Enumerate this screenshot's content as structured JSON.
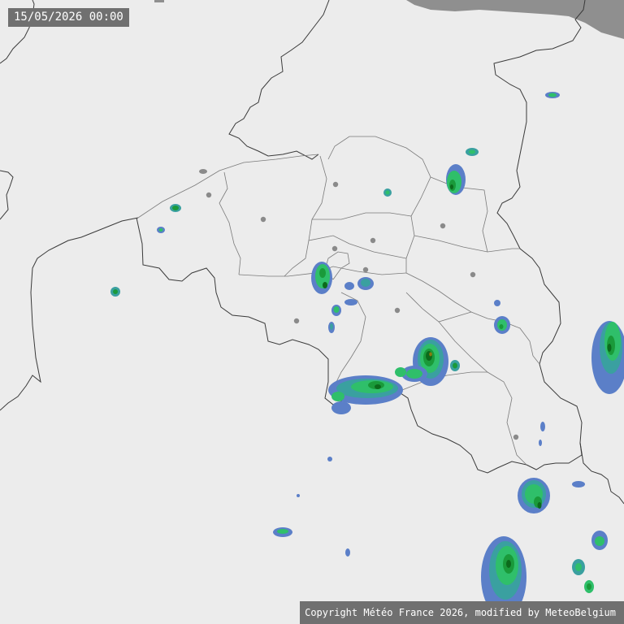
{
  "header": {
    "timestamp": "15/05/2026 00:00"
  },
  "footer": {
    "copyright": "Copyright Météo France 2026, modified by MeteoBelgium"
  },
  "map": {
    "background_color": "#ececec",
    "land_border_color": "#3a3a3a",
    "province_border_color": "#7a7a7a",
    "city_marker_color": "#8a8a8a",
    "no_data_color": "#8f8f8f",
    "radar_palette": [
      "#5b7fc8",
      "#3aa0a0",
      "#2fbf6a",
      "#1a9a3a",
      "#0c6a1c",
      "#8a7a10"
    ]
  }
}
